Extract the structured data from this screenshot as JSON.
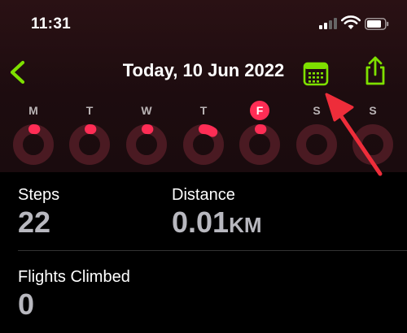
{
  "status_bar": {
    "time": "11:31"
  },
  "header": {
    "title": "Today, 10 Jun 2022"
  },
  "week": {
    "days": [
      {
        "letter": "M",
        "progress": 0.02
      },
      {
        "letter": "T",
        "progress": 0.02
      },
      {
        "letter": "W",
        "progress": 0.02
      },
      {
        "letter": "T",
        "progress": 0.1
      },
      {
        "letter": "F",
        "progress": 0.02,
        "today": true
      },
      {
        "letter": "S",
        "progress": 0
      },
      {
        "letter": "S",
        "progress": 0
      }
    ]
  },
  "stats": {
    "steps": {
      "label": "Steps",
      "value": "22"
    },
    "distance": {
      "label": "Distance",
      "value": "0.01",
      "unit": "KM"
    },
    "flights": {
      "label": "Flights Climbed",
      "value": "0"
    }
  },
  "colors": {
    "accent_green": "#7ee000",
    "ring_red": "#ff2d55",
    "arrow_red": "#ee2d3a"
  }
}
